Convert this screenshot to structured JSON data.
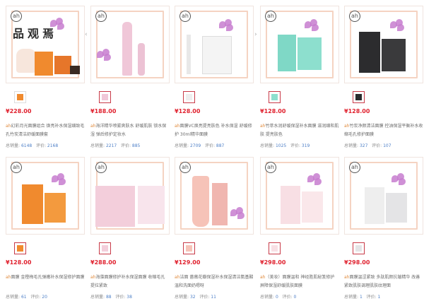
{
  "watermark": "品观焉",
  "products": [
    {
      "price": "¥228.00",
      "brand": "ah",
      "title": "幻彩月光面膜组合 焕亮补水保湿细致毛孔竹炭清洁舒缓面膜套",
      "sales_label": "总销量:",
      "sales": "6148",
      "reviews_label": "评价:",
      "reviews": "2168"
    },
    {
      "price": "¥188.00",
      "brand": "ah",
      "title": "海洋精华喷雾爽肤水 舒缓肌肤 锁水保湿 弹后修护定妆水",
      "sales_label": "总销量:",
      "sales": "2217",
      "reviews_label": "评价:",
      "reviews": "885"
    },
    {
      "price": "¥128.00",
      "brand": "ah",
      "title": "面膜VC焕亮提亮肤色 补水保湿 舒缓修护 30ml精华面膜",
      "sales_label": "总销量:",
      "sales": "2709",
      "reviews_label": "评价:",
      "reviews": "887"
    },
    {
      "price": "¥128.00",
      "brand": "ah",
      "title": "竹萃水润舒缓保湿补水面膜 滋润细和肌肤 提亮肤色",
      "sales_label": "总销量:",
      "sales": "1025",
      "reviews_label": "评价:",
      "reviews": "319"
    },
    {
      "price": "¥128.00",
      "brand": "ah",
      "title": "竹炭净颜清洁面膜 控油保湿平衡补水收缩毛孔修护面膜",
      "sales_label": "总销量:",
      "sales": "327",
      "reviews_label": "评价:",
      "reviews": "107"
    },
    {
      "price": "¥128.00",
      "brand": "ah",
      "title": "面膜 金橙梅毛孔弹嫩补水保湿修护面膜",
      "sales_label": "总销量:",
      "sales": "61",
      "reviews_label": "评价:",
      "reviews": "20"
    },
    {
      "price": "¥288.00",
      "brand": "ah",
      "title": "海藻面膜修护补水保湿面膜 收缩毛孔 提拉紧致",
      "sales_label": "总销量:",
      "sales": "88",
      "reviews_label": "评价:",
      "reviews": "38"
    },
    {
      "price": "¥129.00",
      "brand": "ah",
      "title": "洁面 蔷薇花瓣保湿补水保湿清洁氨基酸温和洗面奶嗯呀",
      "sales_label": "总销量:",
      "sales": "32",
      "reviews_label": "评价:",
      "reviews": "11"
    },
    {
      "price": "¥298.00",
      "brand": "ah",
      "title": "（美妆）面膜温和 神经胜肌秘笈修护 屏障保湿舒缓肌肤面膜",
      "sales_label": "总销量:",
      "sales": "0",
      "reviews_label": "评价:",
      "reviews": "0"
    },
    {
      "price": "¥298.00",
      "brand": "ah",
      "title": "面膜温涩紧致 多肽肌颜抗皱精华 改善紧致肌肤调理肌肤纹理面",
      "sales_label": "总销量:",
      "sales": "1",
      "reviews_label": "评价:",
      "reviews": "1"
    }
  ],
  "colors": {
    "price": "#e0212e",
    "brand": "#e08a3c",
    "link": "#4d7fc7",
    "frame": "#f5d3c2"
  },
  "icons": {
    "logo": "brand-logo-icon",
    "flower": "flower-icon",
    "prev": "chevron-left-icon",
    "next": "chevron-right-icon"
  }
}
